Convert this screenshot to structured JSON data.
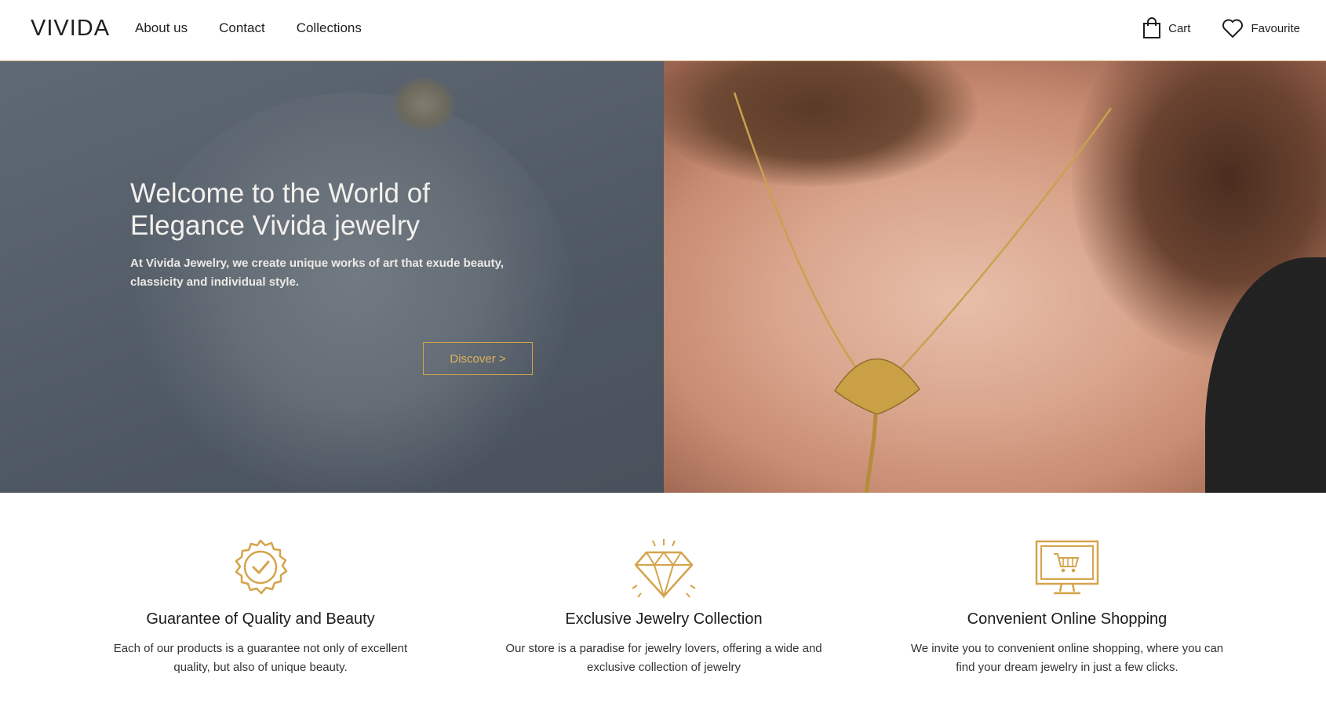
{
  "header": {
    "logo": "VIVIDA",
    "nav": [
      "About us",
      "Contact",
      "Collections"
    ],
    "cart_label": "Cart",
    "favourite_label": "Favourite",
    "icons": {
      "cart": "shopping-bag-icon",
      "favourite": "heart-icon"
    }
  },
  "hero": {
    "title": "Welcome to the World of Elegance Vivida jewelry",
    "subtitle": "At Vivida Jewelry, we create unique works of art that exude beauty, classicity and individual style.",
    "button_label": "Discover >"
  },
  "features": [
    {
      "icon": "quality-badge-icon",
      "title": "Guarantee of Quality and Beauty",
      "text": "Each of our products is a guarantee not only of excellent quality, but also of unique beauty."
    },
    {
      "icon": "diamond-icon",
      "title": "Exclusive Jewelry Collection",
      "text": "Our store is a paradise for jewelry lovers, offering a wide and exclusive collection of jewelry"
    },
    {
      "icon": "online-shopping-icon",
      "title": "Convenient Online Shopping",
      "text": "We invite you to convenient online shopping, where you can find your dream jewelry in just a few clicks."
    }
  ],
  "colors": {
    "accent": "#d4a44c",
    "text": "#1c1c1c"
  }
}
